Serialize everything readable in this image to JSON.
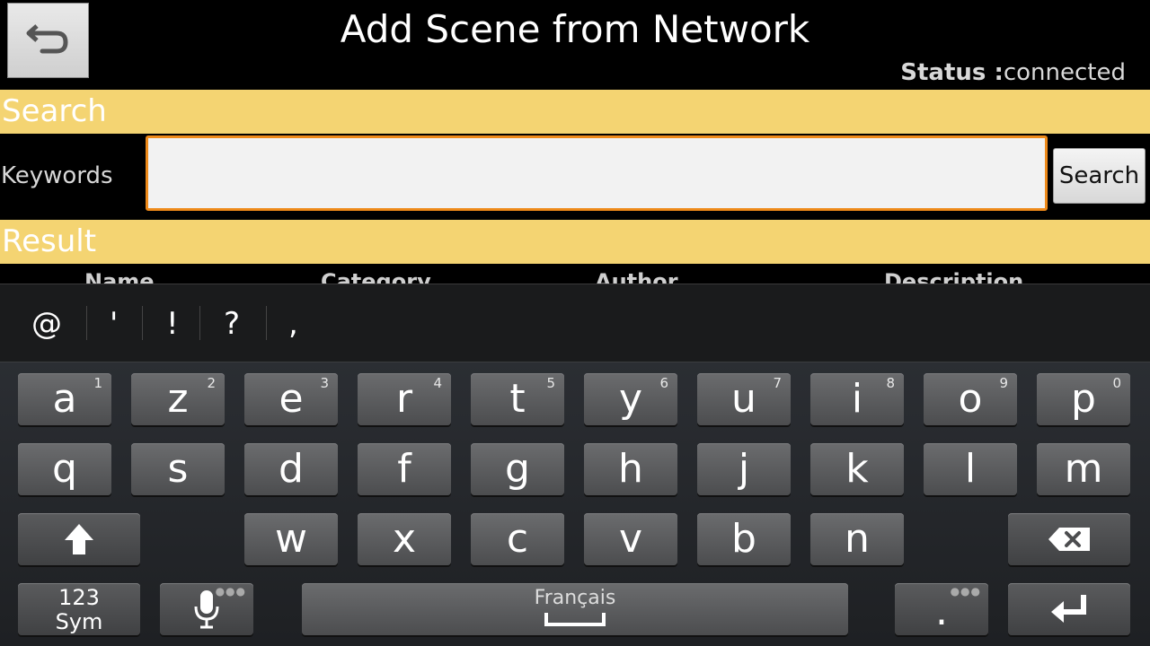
{
  "header": {
    "back_icon": "undo-arrow-icon",
    "title": "Add Scene from Network",
    "status_label": "Status :",
    "status_value": "connected"
  },
  "search_section": {
    "heading": "Search",
    "keywords_label": "Keywords",
    "input_value": "",
    "search_button": "Search"
  },
  "result_section": {
    "heading": "Result",
    "columns": [
      "Name",
      "Category",
      "Author",
      "Description"
    ]
  },
  "keyboard": {
    "suggestions": [
      "@",
      "'",
      "!",
      "?",
      ","
    ],
    "row1": [
      {
        "key": "a",
        "sup": "1"
      },
      {
        "key": "z",
        "sup": "2"
      },
      {
        "key": "e",
        "sup": "3"
      },
      {
        "key": "r",
        "sup": "4"
      },
      {
        "key": "t",
        "sup": "5"
      },
      {
        "key": "y",
        "sup": "6"
      },
      {
        "key": "u",
        "sup": "7"
      },
      {
        "key": "i",
        "sup": "8"
      },
      {
        "key": "o",
        "sup": "9"
      },
      {
        "key": "p",
        "sup": "0"
      }
    ],
    "row2": [
      "q",
      "s",
      "d",
      "f",
      "g",
      "h",
      "j",
      "k",
      "l",
      "m"
    ],
    "row3": [
      "w",
      "x",
      "c",
      "v",
      "b",
      "n"
    ],
    "symbols_line1": "123",
    "symbols_line2": "Sym",
    "space_label": "Français",
    "period": ".",
    "shift_icon": "shift-arrow-icon",
    "backspace_icon": "backspace-icon",
    "mic_icon": "microphone-icon",
    "enter_icon": "enter-return-icon"
  },
  "colors": {
    "section_band": "#f4d472",
    "input_focus_border": "#ee8a1a"
  }
}
